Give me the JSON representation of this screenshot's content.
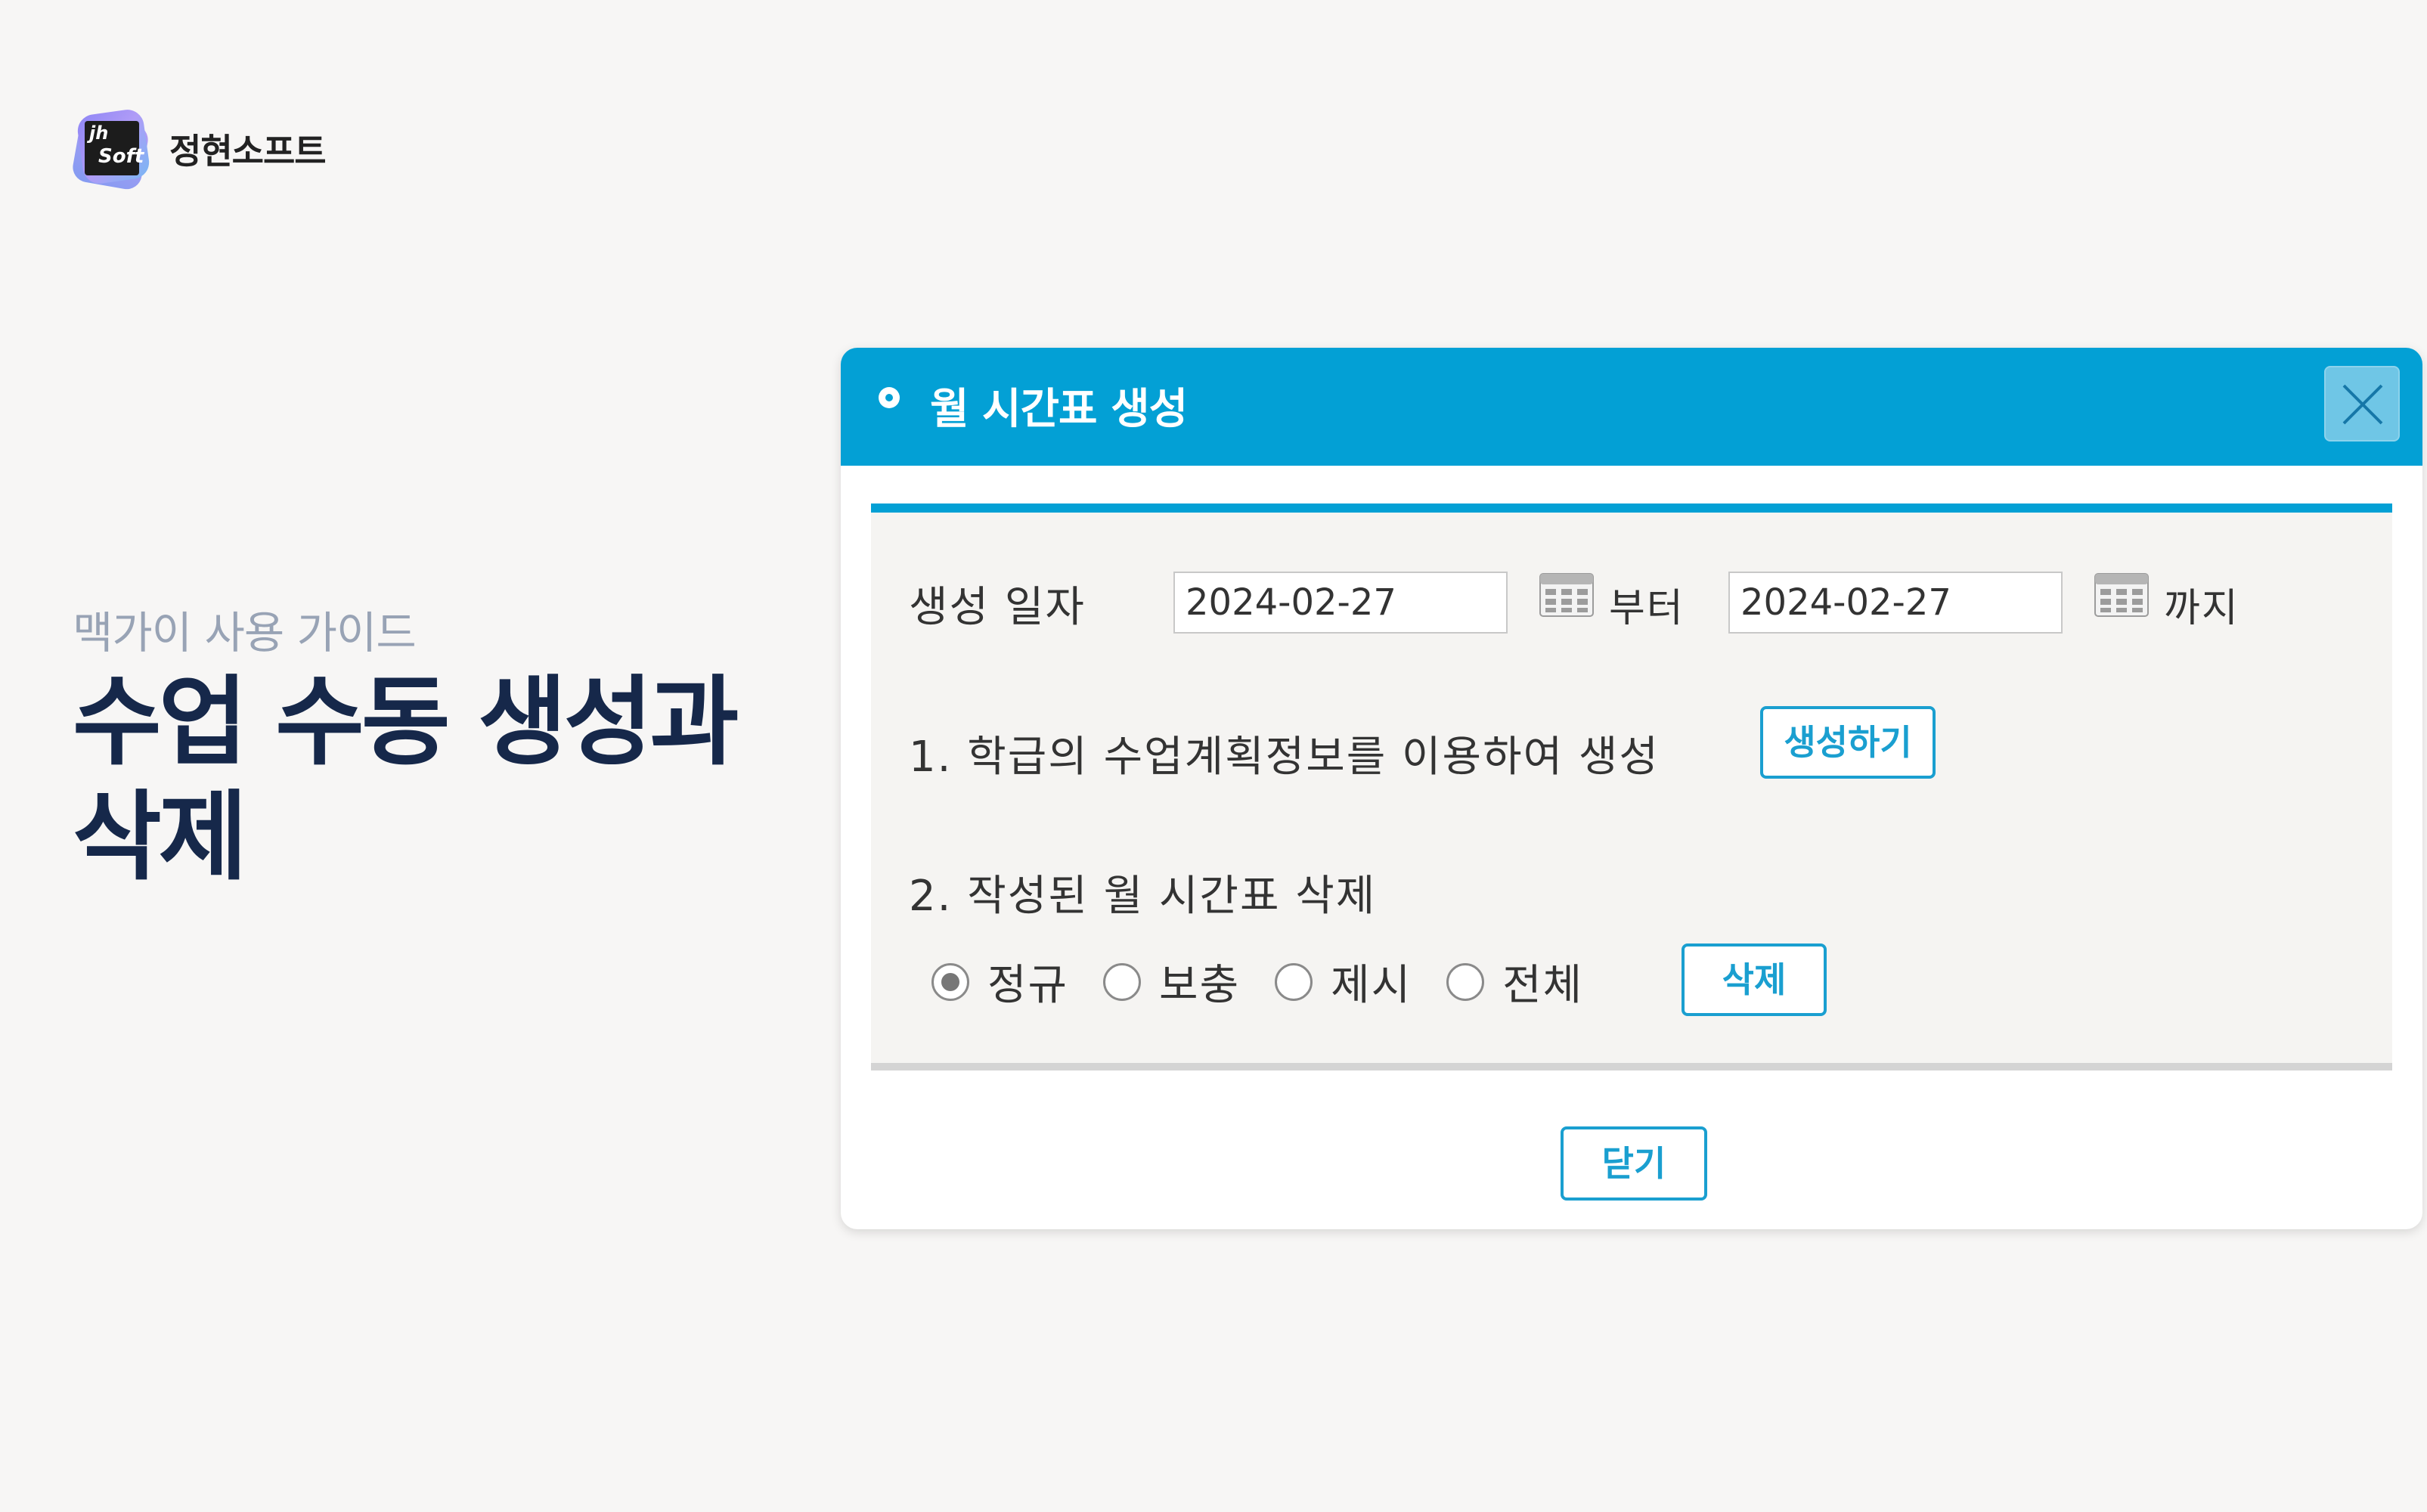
{
  "brand": {
    "name": "정현소프트",
    "logo_text_top": "jh",
    "logo_text_bottom": "Soft",
    "logo_icon": "jhsoft-logo-icon"
  },
  "guide": {
    "label": "맥가이 사용 가이드",
    "title": "수업 수동 생성과 삭제"
  },
  "dialog": {
    "title": "월 시간표 생성",
    "close_icon": "close-icon",
    "header_color": "#03a0d5",
    "date_row": {
      "label": "생성 일자",
      "from_value": "2024-02-27",
      "from_suffix": "부터",
      "to_value": "2024-02-27",
      "to_suffix": "까지",
      "calendar_icon": "calendar-icon"
    },
    "section1": {
      "text": "1. 학급의 수업계획정보를 이용하여 생성",
      "button": "생성하기"
    },
    "section2": {
      "text": "2. 작성된 월 시간표 삭제",
      "options": [
        {
          "label": "정규",
          "checked": true
        },
        {
          "label": "보충",
          "checked": false
        },
        {
          "label": "제시",
          "checked": false
        },
        {
          "label": "전체",
          "checked": false
        }
      ],
      "button": "삭제"
    },
    "footer_button": "닫기"
  }
}
